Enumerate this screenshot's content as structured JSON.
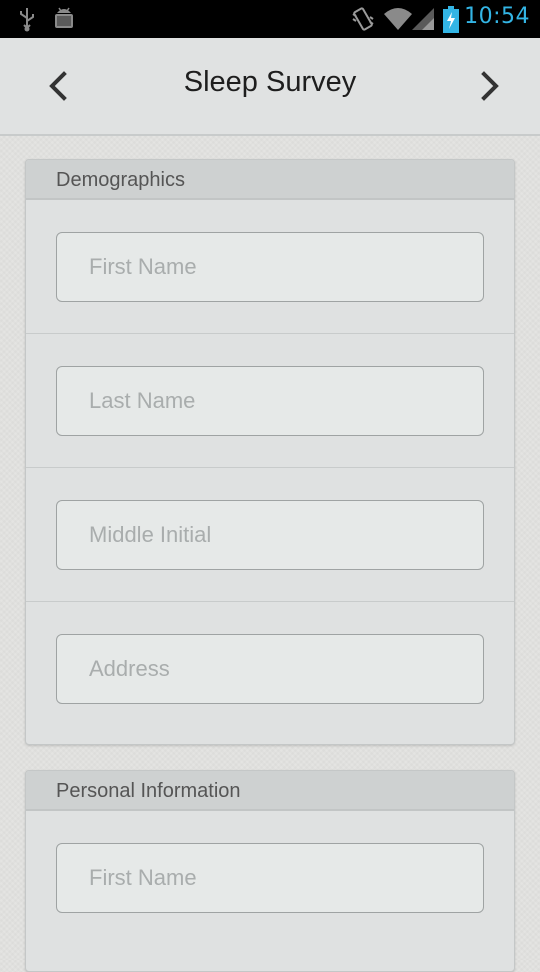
{
  "status_bar": {
    "time": "10:54",
    "icons": [
      "usb-icon",
      "android-debug-icon",
      "vibrate-icon",
      "wifi-icon",
      "signal-icon",
      "battery-charging-icon"
    ],
    "accent_color": "#33b5e5"
  },
  "nav": {
    "title": "Sleep Survey",
    "back_icon": "chevron-left-icon",
    "forward_icon": "chevron-right-icon"
  },
  "sections": [
    {
      "title": "Demographics",
      "fields": [
        {
          "placeholder": "First Name",
          "value": ""
        },
        {
          "placeholder": "Last Name",
          "value": ""
        },
        {
          "placeholder": "Middle Initial",
          "value": ""
        },
        {
          "placeholder": "Address",
          "value": ""
        }
      ]
    },
    {
      "title": "Personal Information",
      "fields": [
        {
          "placeholder": "First Name",
          "value": ""
        }
      ]
    }
  ]
}
